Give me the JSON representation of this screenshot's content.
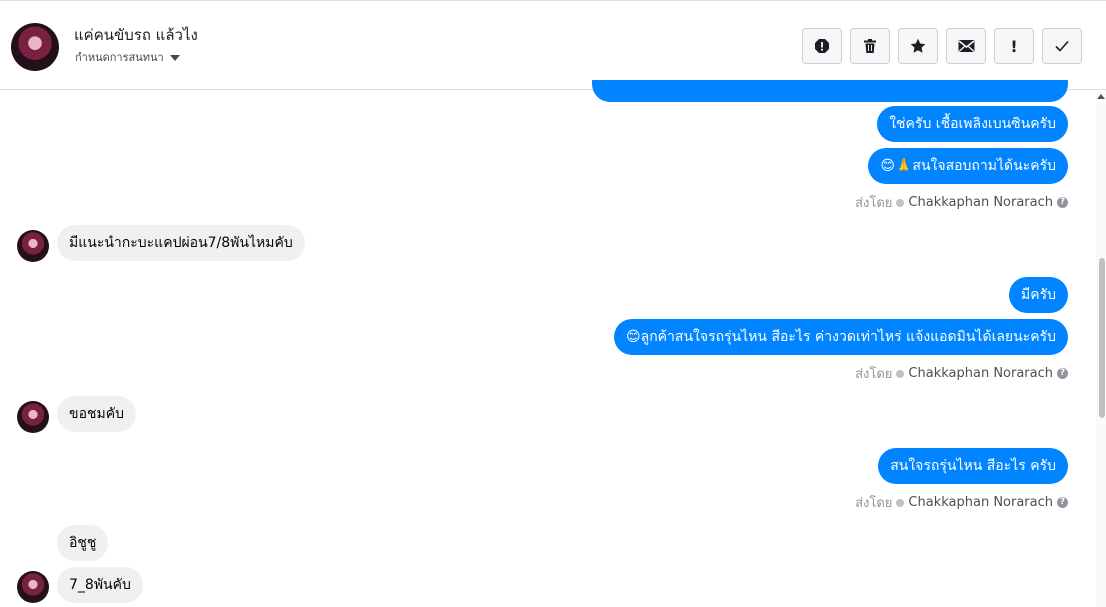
{
  "header": {
    "contact_name": "แค่คนขับรถ แล้วไง",
    "assign_label": "กำหนดการสนทนา",
    "tools": [
      {
        "icon": "alert-circle-icon"
      },
      {
        "icon": "trash-icon"
      },
      {
        "icon": "star-icon"
      },
      {
        "icon": "envelope-icon"
      },
      {
        "icon": "exclamation-icon",
        "label": "!"
      },
      {
        "icon": "checkmark-icon"
      }
    ]
  },
  "messages": {
    "out1": "ใช่ครับ เชื้อเพลิงเบนซินครับ",
    "out2": "😊🙏สนใจสอบถามได้นะครับ",
    "in1": "มีแนะนำกะบะแคปผ่อน7/8พันไหมคับ",
    "out3": "มีครับ",
    "out4": "😊ลูกค้าสนใจรถรุ่นไหน สีอะไร ค่างวดเท่าไหร่ แจ้งแอดมินได้เลยนะครับ",
    "in2": "ขอชมคับ",
    "out5": "สนใจรถรุ่นไหน สีอะไร ครับ",
    "in3": "อิชูชู",
    "in4": "7_8พันคับ"
  },
  "sent_by": {
    "label": "ส่งโดย",
    "sender": "Chakkaphan Norarach"
  },
  "colors": {
    "outgoing_bubble": "#0084ff",
    "incoming_bubble": "#f1f0f0"
  }
}
